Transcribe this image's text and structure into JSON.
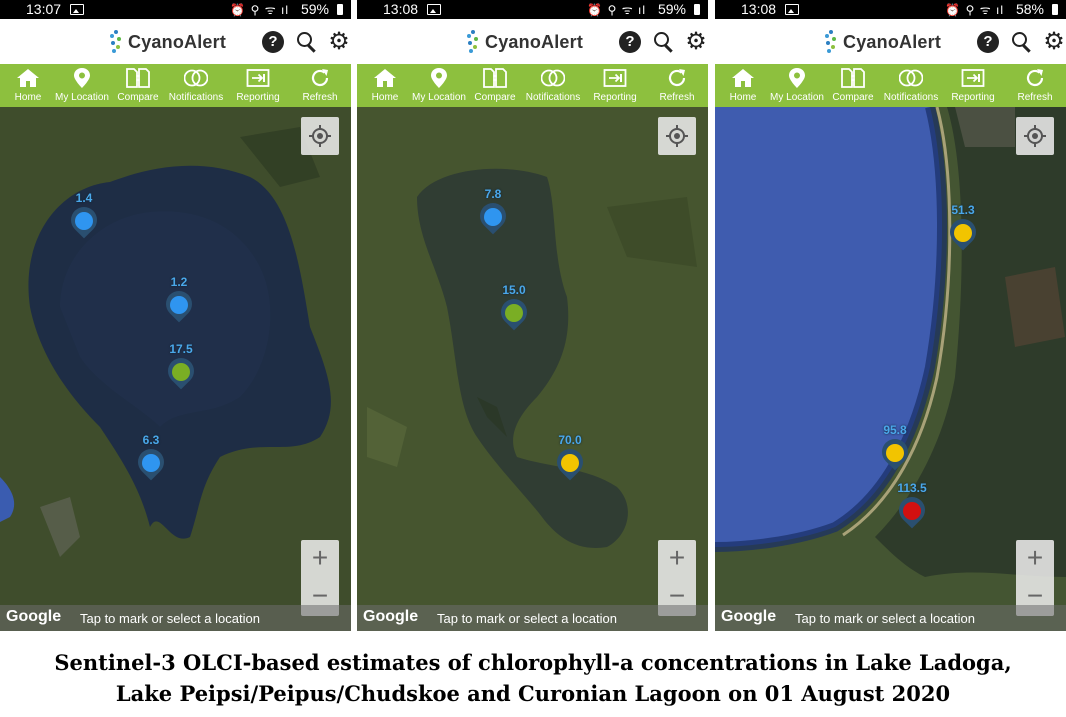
{
  "app": {
    "name": "CyanoAlert",
    "help_glyph": "?",
    "gear_glyph": "⚙"
  },
  "nav": [
    "Home",
    "My Location",
    "Compare",
    "Notifications",
    "Reporting",
    "Refresh"
  ],
  "map_footer": {
    "google": "Google",
    "hint": "Tap to mark or select a location"
  },
  "zoom": {
    "in": "+",
    "out": "−"
  },
  "colors": {
    "nav_green": "#8dc03e",
    "marker_blue": "#2f95f0",
    "marker_green": "#7aae24",
    "marker_yellow": "#f2c400",
    "marker_red": "#d21010"
  },
  "screens": [
    {
      "time": "13:07",
      "battery": "59%",
      "markers": [
        {
          "label": "1.4",
          "color": "blue"
        },
        {
          "label": "1.2",
          "color": "blue"
        },
        {
          "label": "17.5",
          "color": "green"
        },
        {
          "label": "6.3",
          "color": "blue"
        }
      ]
    },
    {
      "time": "13:08",
      "battery": "59%",
      "markers": [
        {
          "label": "7.8",
          "color": "blue"
        },
        {
          "label": "15.0",
          "color": "green"
        },
        {
          "label": "70.0",
          "color": "yellow"
        }
      ]
    },
    {
      "time": "13:08",
      "battery": "58%",
      "markers": [
        {
          "label": "51.3",
          "color": "yellow"
        },
        {
          "label": "95.8",
          "color": "yellow"
        },
        {
          "label": "113.5",
          "color": "red"
        }
      ]
    }
  ],
  "caption": {
    "line1": "Sentinel-3 OLCI-based estimates of chlorophyll-a concentrations in Lake Ladoga,",
    "line2": "Lake Peipsi/Peipus/Chudskoe and Curonian Lagoon on 01 August 2020"
  }
}
